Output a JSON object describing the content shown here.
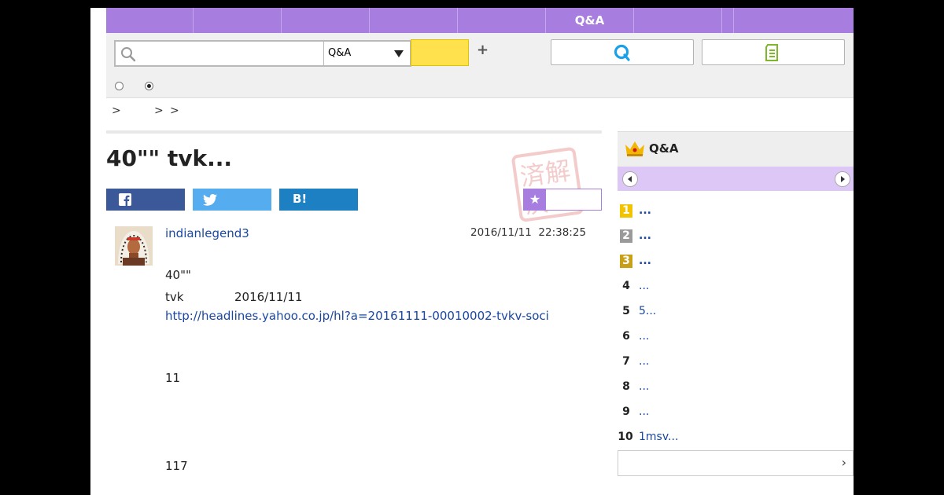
{
  "nav": {
    "items": [
      "",
      "",
      "",
      "",
      "",
      "Q&A",
      "",
      "",
      ""
    ]
  },
  "search": {
    "placeholder": "",
    "category": "Q&A",
    "plus": "+"
  },
  "breadcrumb": {
    "sep": ">"
  },
  "question": {
    "title": "40\"\" tvk...",
    "username": "indianlegend3",
    "date": "2016/11/11",
    "time": "22:38:25",
    "lines": [
      "40\"\"",
      "tvk",
      "2016/11/11",
      "http://headlines.yahoo.co.jp/hl?a=20161111-00010002-tvkv-soci",
      "11",
      "117"
    ]
  },
  "share": {
    "hatena": "B!"
  },
  "sidebar": {
    "title": "Q&A",
    "ranking": [
      {
        "rank": "1",
        "text": "...",
        "medal": "#f2c300"
      },
      {
        "rank": "2",
        "text": "...",
        "medal": "#9a9a9a"
      },
      {
        "rank": "3",
        "text": "...",
        "medal": "#c8a018"
      },
      {
        "rank": "4",
        "text": "..."
      },
      {
        "rank": "5",
        "text": "5..."
      },
      {
        "rank": "6",
        "text": "..."
      },
      {
        "rank": "7",
        "text": "..."
      },
      {
        "rank": "8",
        "text": "..."
      },
      {
        "rank": "9",
        "text": "..."
      },
      {
        "rank": "10",
        "text": "1msv..."
      }
    ]
  },
  "colors": {
    "nav": "#a77ee0",
    "accent_yellow": "#ffe14d",
    "facebook": "#3b5998",
    "twitter": "#55acee",
    "hatena": "#1d80c3",
    "link": "#1a47a0"
  },
  "icons": {
    "search": "search-icon",
    "qa_logo": "q-logo-icon",
    "post": "document-icon",
    "crown": "crown-icon",
    "stamp": "solved-stamp"
  }
}
